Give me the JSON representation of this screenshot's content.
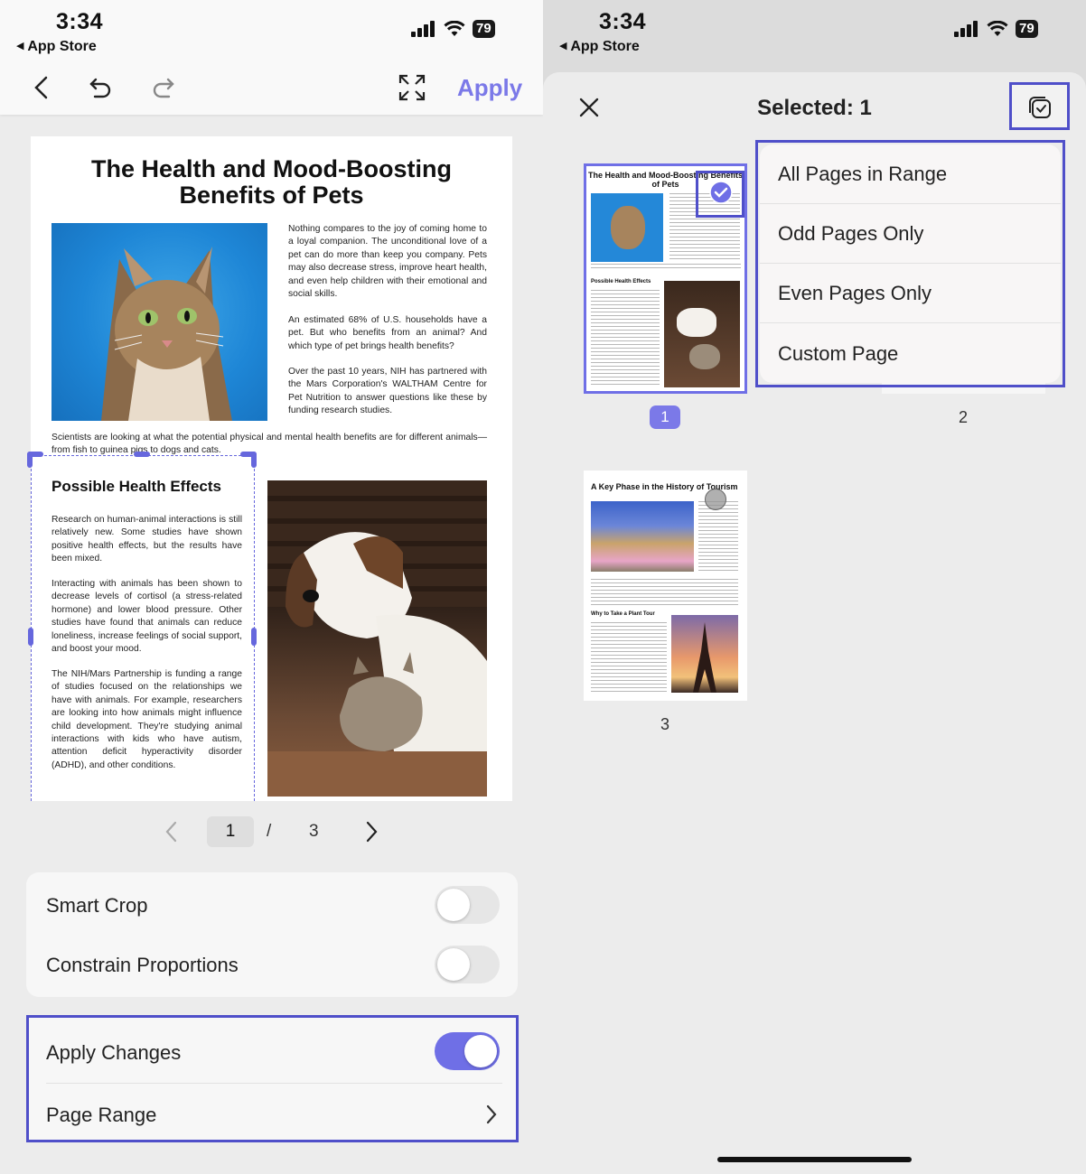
{
  "status": {
    "time": "3:34",
    "back_app": "App Store",
    "battery": "79"
  },
  "left": {
    "toolbar": {
      "apply_label": "Apply"
    },
    "document": {
      "title_line1": "The Health and Mood-Boosting",
      "title_line2": "Benefits of Pets",
      "intro_para1": "Nothing compares to the joy of coming home to a loyal companion. The unconditional love of a pet can do more than keep you company. Pets may also decrease stress, improve heart health, and even help children with their emotional and social skills.",
      "intro_para2": "An estimated 68% of U.S. households have a pet. But who benefits from an animal? And which type of pet brings health benefits?",
      "intro_para3": "Over the past 10 years, NIH has partnered with the Mars Corporation's WALTHAM Centre for Pet Nutrition to answer questions like these by funding research studies.",
      "full_para": "Scientists are looking at what the potential physical and mental health benefits are for different animals—from fish to guinea pigs to dogs and cats.",
      "section_heading": "Possible Health Effects",
      "section_para1": "Research on human-animal interactions is still relatively new. Some studies have shown positive health effects, but the results have been mixed.",
      "section_para2": "Interacting with animals has been shown to decrease levels of cortisol (a stress-related hormone) and lower blood pressure. Other studies have found that animals can reduce loneliness, increase feelings of social support, and boost your mood.",
      "section_para3": "The NIH/Mars Partnership is funding a range of studies focused on the relationships we have with animals. For example, researchers are looking into how animals might influence child development. They're studying animal interactions with kids who have autism, attention deficit hyperactivity disorder (ADHD), and other conditions."
    },
    "pager": {
      "current": "1",
      "separator": "/",
      "total": "3"
    },
    "settings": {
      "smart_crop": {
        "label": "Smart Crop",
        "on": false
      },
      "constrain": {
        "label": "Constrain Proportions",
        "on": false
      },
      "apply_changes": {
        "label": "Apply Changes",
        "on": true
      },
      "page_range": {
        "label": "Page Range"
      }
    }
  },
  "right": {
    "header": {
      "selected_label": "Selected: 1"
    },
    "thumbnails": [
      {
        "number": "1",
        "title": "The Health and Mood-Boosting Benefits of Pets",
        "heading": "Possible Health Effects",
        "selected": true
      },
      {
        "number": "2"
      },
      {
        "number": "3",
        "title": "A Key Phase in the History of Tourism",
        "heading": "Why to Take a Plant Tour"
      }
    ],
    "menu": {
      "items": [
        "All Pages in Range",
        "Odd Pages Only",
        "Even Pages Only",
        "Custom Page"
      ]
    }
  },
  "colors": {
    "accent": "#7b79e8",
    "highlight": "#4f4fc9"
  }
}
